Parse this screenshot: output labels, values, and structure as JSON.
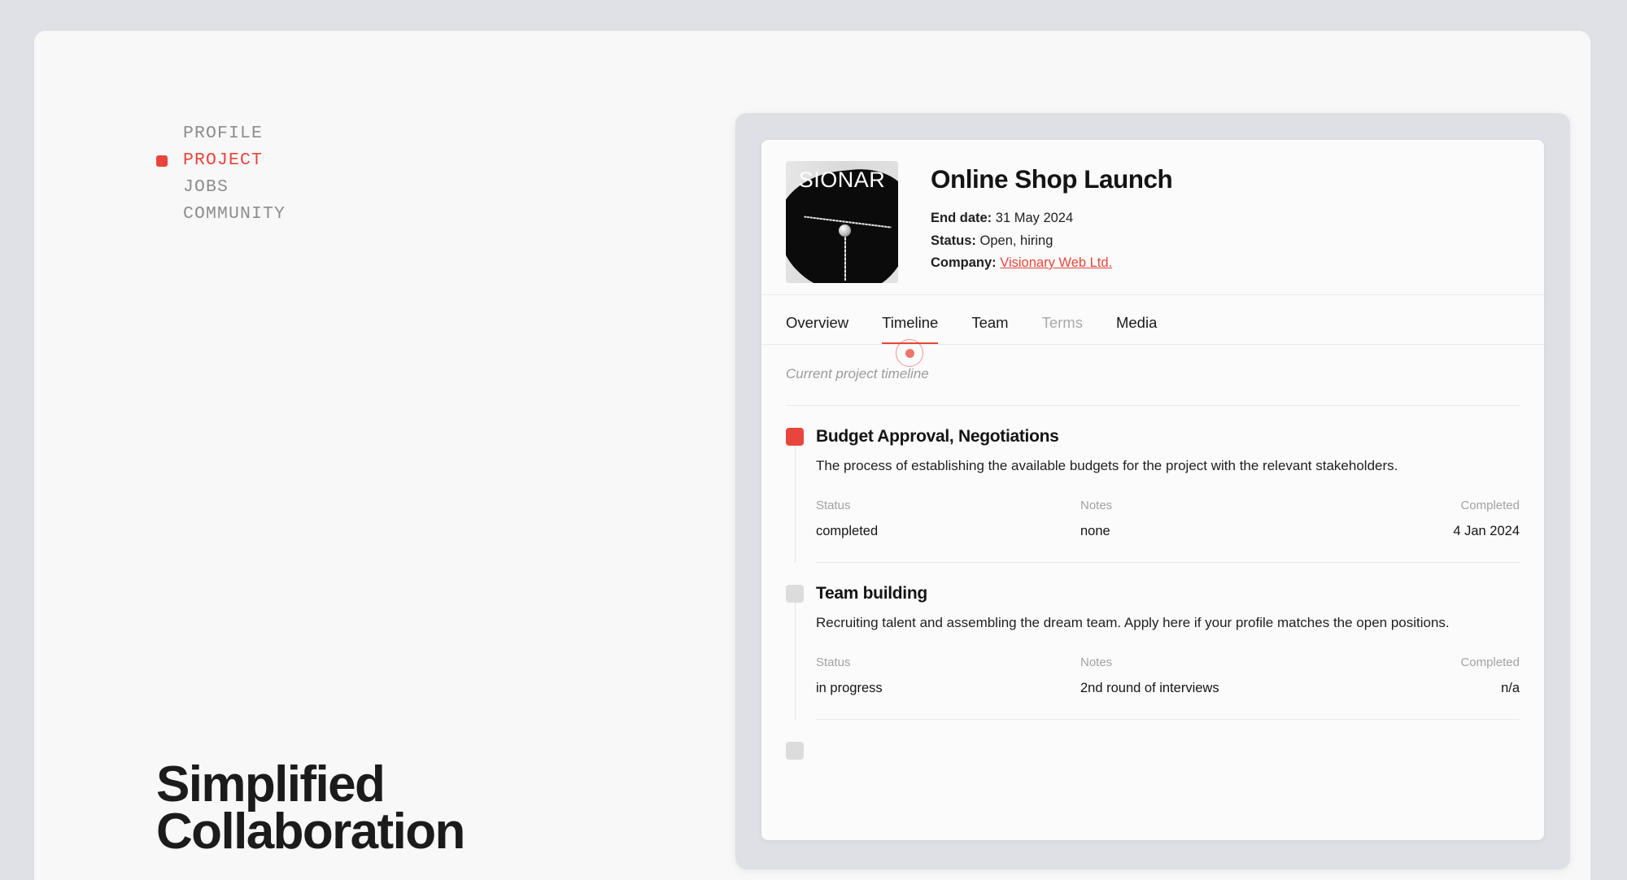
{
  "hero": {
    "headline_line1": "Simplified",
    "headline_line2": "Collaboration"
  },
  "sidebar": {
    "items": [
      {
        "label": "PROFILE",
        "active": false
      },
      {
        "label": "PROJECT",
        "active": true
      },
      {
        "label": "JOBS",
        "active": false
      },
      {
        "label": "COMMUNITY",
        "active": false
      }
    ]
  },
  "project": {
    "thumbnail_text": "SIONAR",
    "title": "Online Shop Launch",
    "end_date_label": "End date:",
    "end_date_value": "31 May 2024",
    "status_label": "Status:",
    "status_value": "Open, hiring",
    "company_label": "Company:",
    "company_value": "Visionary Web Ltd."
  },
  "tabs": [
    {
      "label": "Overview",
      "state": "normal"
    },
    {
      "label": "Timeline",
      "state": "active"
    },
    {
      "label": "Team",
      "state": "normal"
    },
    {
      "label": "Terms",
      "state": "disabled"
    },
    {
      "label": "Media",
      "state": "normal"
    }
  ],
  "timeline": {
    "caption": "Current project timeline",
    "field_labels": {
      "status": "Status",
      "notes": "Notes",
      "completed": "Completed"
    },
    "items": [
      {
        "marker": "done",
        "title": "Budget Approval, Negotiations",
        "description": "The process of establishing the available budgets for the project with the relevant stakeholders.",
        "status": "completed",
        "notes": "none",
        "completed": "4 Jan 2024"
      },
      {
        "marker": "pending",
        "title": "Team building",
        "description": "Recruiting talent and assembling the dream team. Apply here if your profile matches the open positions.",
        "status": "in progress",
        "notes": "2nd round of interviews",
        "completed": "n/a"
      }
    ]
  },
  "colors": {
    "accent": "#e8453c",
    "page_background": "#e0e0e7",
    "panel_background": "#f8f8f8",
    "card_background": "#fbfbfb",
    "card_frame": "#dfdfe6",
    "muted_text": "#a2a2a2"
  }
}
